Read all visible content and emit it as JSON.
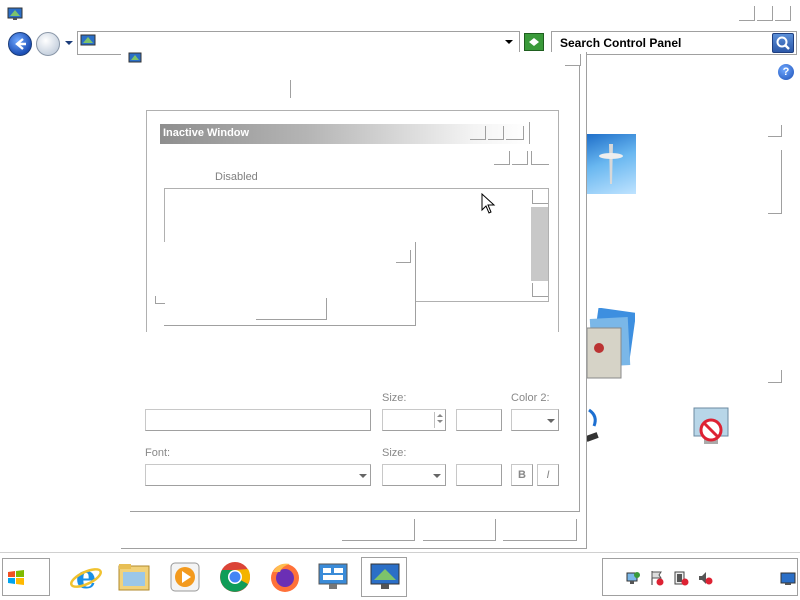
{
  "search": {
    "placeholder": "Search Control Panel"
  },
  "preview": {
    "inactive_title": "Inactive Window",
    "disabled_label": "Disabled"
  },
  "form": {
    "size_label_1": "Size:",
    "color2_label": "Color 2:",
    "font_label": "Font:",
    "size_label_2": "Size:",
    "bold_label": "B",
    "italic_label": "I"
  },
  "help_icon_label": "?",
  "taskbar": {
    "apps": [
      "internet-explorer",
      "file-explorer",
      "media-player",
      "chrome",
      "firefox",
      "control-panel",
      "display-settings"
    ]
  },
  "colors": {
    "inactive_title_start": "#8e8e8e",
    "back_button": "#1c4fb5",
    "search_button": "#2c58a8"
  }
}
